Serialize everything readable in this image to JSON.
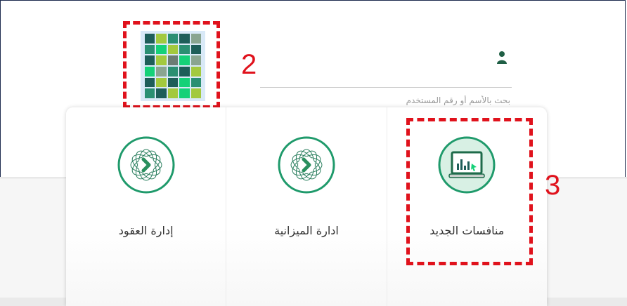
{
  "search": {
    "placeholder": "بحث بالأسم أو رقم المستخدم"
  },
  "annotations": {
    "marker_2": "2",
    "marker_3": "3",
    "accent_color": "#e0121c"
  },
  "apps_panel": {
    "tiles": [
      {
        "label": "إدارة العقود",
        "icon": "etimad-seal-icon"
      },
      {
        "label": "ادارة الميزانية",
        "icon": "etimad-seal-icon"
      },
      {
        "label": "منافسات الجديد",
        "icon": "laptop-chart-icon"
      }
    ]
  },
  "colors": {
    "brand_green": "#1f9a6b",
    "brand_dark": "#1e6b4a",
    "grid_palette": [
      "#1e5e59",
      "#2a8f72",
      "#15d178",
      "#8aa590",
      "#a3c93e",
      "#6c7c74"
    ]
  }
}
